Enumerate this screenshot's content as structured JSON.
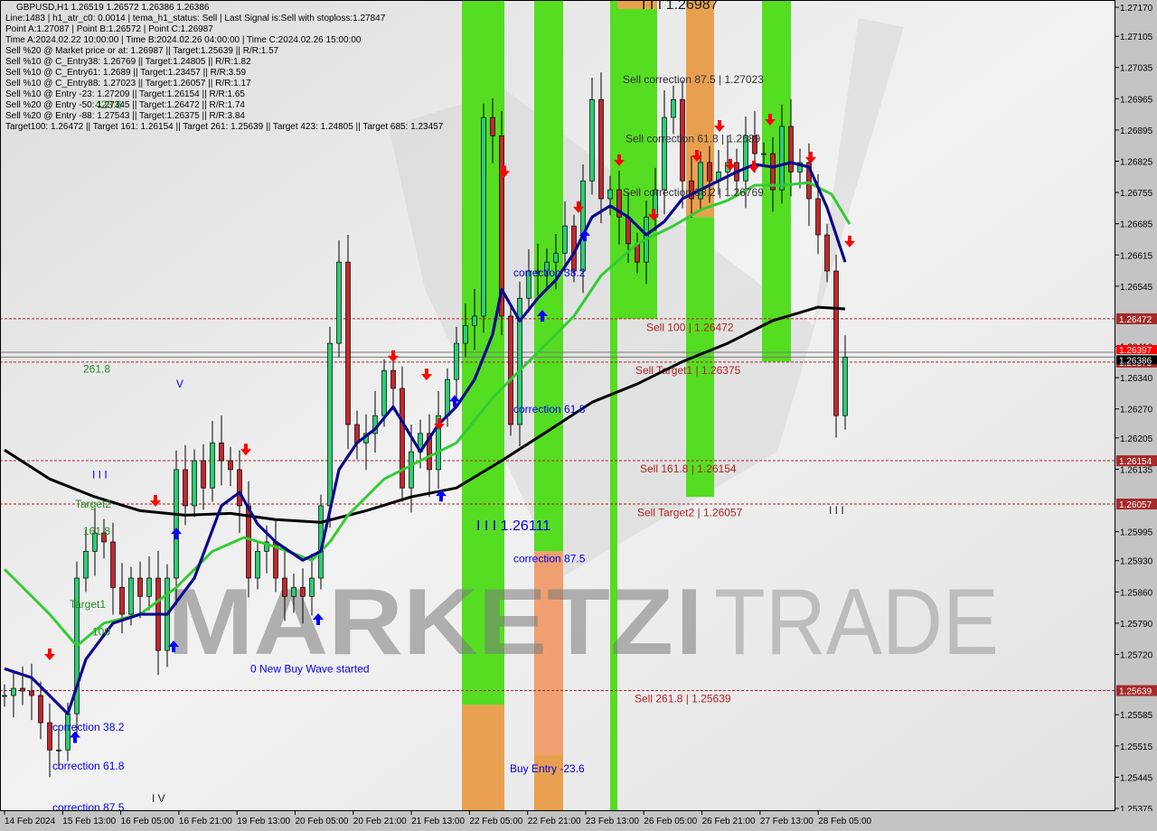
{
  "header": {
    "title": "GBPUSD,H1  1.26519 1.26572 1.26386 1.26386",
    "lines": [
      "Line:1483 | h1_atr_c0: 0.0014 | tema_h1_status: Sell | Last Signal is:Sell with stoploss:1.27847",
      "Point A:1.27087 | Point B:1.26572 | Point C:1.26987",
      "Time A:2024.02.22 10:00:00 | Time B:2024.02.26 04:00:00 | Time C:2024.02.26 15:00:00",
      "Sell %20 @ Market price or at: 1.26987 || Target:1.25639 || R/R:1.57",
      "Sell %10 @ C_Entry38: 1.26769 || Target:1.24805 || R/R:1.82",
      "Sell %10 @ C_Entry61: 1.2689 || Target:1.23457 || R/R:3.59",
      "Sell %10 @ C_Entry88: 1.27023 || Target:1.26057 || R/R:1.17",
      "Sell %10 @ Entry -23: 1.27209 || Target:1.26154 || R/R:1.65",
      "Sell %20 @ Entry -50: 1.27345 || Target:1.26472 || R/R:1.74",
      "Sell %20 @ Entry -88: 1.27543 || Target:1.26375 || R/R:3.84",
      "Target100: 1.26472 || Target 161: 1.26154 || Target 261: 1.25639 || Target 423: 1.24805 || Target 685: 1.23457"
    ]
  },
  "watermark": {
    "part1": "MARKETZ",
    "part2": "I",
    "part3": "TRADE"
  },
  "colors": {
    "bull": "#2ecc71",
    "bear": "#c0282d",
    "tema": "#0a0a8c",
    "ma_green": "#33cc33",
    "ma_black": "#000000",
    "zone_green": "#55dd22",
    "zone_orange": "#e8a050",
    "zone_salmon": "#f0a070",
    "level_red": "#b22222",
    "label_blue": "#0000ee"
  },
  "chart_data": {
    "type": "candlestick",
    "symbol": "GBPUSD",
    "timeframe": "H1",
    "ylim": [
      1.2534,
      1.2719
    ],
    "grid": false,
    "y_ticks": [
      "1.27170",
      "1.27105",
      "1.27035",
      "1.26965",
      "1.26895",
      "1.26825",
      "1.26755",
      "1.26685",
      "1.26615",
      "1.26545",
      "1.26410",
      "1.26340",
      "1.26270",
      "1.26205",
      "1.26135",
      "1.25995",
      "1.25930",
      "1.25860",
      "1.25790",
      "1.25720",
      "1.25585",
      "1.25515",
      "1.25445",
      "1.25375"
    ],
    "x_ticks": [
      "14 Feb 2024",
      "15 Feb 13:00",
      "16 Feb 05:00",
      "16 Feb 21:00",
      "19 Feb 13:00",
      "20 Feb 05:00",
      "20 Feb 21:00",
      "21 Feb 13:00",
      "22 Feb 05:00",
      "22 Feb 21:00",
      "23 Feb 13:00",
      "26 Feb 05:00",
      "26 Feb 21:00",
      "27 Feb 13:00",
      "28 Feb 05:00"
    ],
    "closes": [
      1.25628,
      1.25644,
      1.25638,
      1.25628,
      1.25567,
      1.25506,
      1.25506,
      1.25587,
      1.25891,
      1.25951,
      1.25992,
      1.25972,
      1.2587,
      1.2581,
      1.25891,
      1.2585,
      1.25891,
      1.25729,
      1.25891,
      1.26134,
      1.26053,
      1.26154,
      1.26093,
      1.26194,
      1.26154,
      1.26134,
      1.26053,
      1.25891,
      1.25951,
      1.25972,
      1.25891,
      1.2585,
      1.2587,
      1.2585,
      1.25891,
      1.26053,
      1.26417,
      1.26599,
      1.26235,
      1.26194,
      1.26215,
      1.26255,
      1.26356,
      1.26316,
      1.26093,
      1.26174,
      1.26215,
      1.26134,
      1.26255,
      1.26336,
      1.26417,
      1.26457,
      1.26478,
      1.26923,
      1.26882,
      1.26478,
      1.26235,
      1.26518,
      1.26579,
      1.26579,
      1.26599,
      1.26619,
      1.2668,
      1.26579,
      1.26781,
      1.26963,
      1.26741,
      1.26761,
      1.267,
      1.2664,
      1.26599,
      1.267,
      1.26761,
      1.26923,
      1.26963,
      1.26781,
      1.26741,
      1.26822,
      1.26781,
      1.26801,
      1.26822,
      1.26781,
      1.26882,
      1.26842,
      1.26842,
      1.26761,
      1.26903,
      1.26801,
      1.26822,
      1.26741,
      1.2666,
      1.26579,
      1.26255,
      1.26386
    ],
    "lines": {
      "ma_black": [
        [
          0,
          1.26178
        ],
        [
          5,
          1.26113
        ],
        [
          10,
          1.26073
        ],
        [
          15,
          1.26042
        ],
        [
          20,
          1.26032
        ],
        [
          25,
          1.26036
        ],
        [
          30,
          1.26022
        ],
        [
          35,
          1.26016
        ],
        [
          40,
          1.26042
        ],
        [
          45,
          1.26073
        ],
        [
          50,
          1.26093
        ],
        [
          55,
          1.26154
        ],
        [
          60,
          1.26219
        ],
        [
          65,
          1.26285
        ],
        [
          70,
          1.26326
        ],
        [
          75,
          1.26376
        ],
        [
          80,
          1.26417
        ],
        [
          85,
          1.26468
        ],
        [
          90,
          1.26498
        ],
        [
          93,
          1.26494
        ]
      ],
      "tema_blue": [
        [
          0,
          1.25688
        ],
        [
          3,
          1.25668
        ],
        [
          7,
          1.25587
        ],
        [
          9,
          1.25709
        ],
        [
          12,
          1.2579
        ],
        [
          15,
          1.2581
        ],
        [
          18,
          1.2581
        ],
        [
          21,
          1.25891
        ],
        [
          24,
          1.26053
        ],
        [
          26,
          1.26083
        ],
        [
          28,
          1.26012
        ],
        [
          30,
          1.25972
        ],
        [
          33,
          1.25931
        ],
        [
          35,
          1.25951
        ],
        [
          37,
          1.26134
        ],
        [
          39,
          1.26194
        ],
        [
          41,
          1.26225
        ],
        [
          43,
          1.26275
        ],
        [
          46,
          1.26174
        ],
        [
          48,
          1.26235
        ],
        [
          50,
          1.26275
        ],
        [
          52,
          1.26336
        ],
        [
          54,
          1.26437
        ],
        [
          55,
          1.26538
        ],
        [
          57,
          1.26467
        ],
        [
          59,
          1.26518
        ],
        [
          61,
          1.26559
        ],
        [
          63,
          1.26619
        ],
        [
          65,
          1.267
        ],
        [
          67,
          1.26725
        ],
        [
          69,
          1.267
        ],
        [
          71,
          1.2666
        ],
        [
          73,
          1.2669
        ],
        [
          75,
          1.26741
        ],
        [
          77,
          1.26761
        ],
        [
          79,
          1.26781
        ],
        [
          81,
          1.26801
        ],
        [
          83,
          1.26818
        ],
        [
          85,
          1.26812
        ],
        [
          87,
          1.26822
        ],
        [
          89,
          1.26812
        ],
        [
          91,
          1.26721
        ],
        [
          93,
          1.26599
        ]
      ],
      "ma_green": [
        [
          0,
          1.25911
        ],
        [
          5,
          1.2581
        ],
        [
          8,
          1.25739
        ],
        [
          11,
          1.2579
        ],
        [
          15,
          1.2581
        ],
        [
          19,
          1.2587
        ],
        [
          23,
          1.25951
        ],
        [
          26.5,
          1.25982
        ],
        [
          30,
          1.25961
        ],
        [
          34,
          1.25931
        ],
        [
          36,
          1.25972
        ],
        [
          38,
          1.26032
        ],
        [
          42,
          1.26113
        ],
        [
          46,
          1.26154
        ],
        [
          50,
          1.26194
        ],
        [
          54,
          1.26295
        ],
        [
          56.5,
          1.26346
        ],
        [
          60,
          1.26417
        ],
        [
          63,
          1.26478
        ],
        [
          66,
          1.26569
        ],
        [
          70,
          1.2664
        ],
        [
          74,
          1.2668
        ],
        [
          77,
          1.26716
        ],
        [
          80,
          1.26737
        ],
        [
          83,
          1.26771
        ],
        [
          86,
          1.26771
        ],
        [
          89,
          1.26777
        ],
        [
          91.5,
          1.26751
        ],
        [
          93.5,
          1.26684
        ]
      ]
    },
    "zones": [
      {
        "from": 50.6,
        "to": 55.3,
        "top": 1.2719,
        "bottom": 1.25607,
        "kind": "green"
      },
      {
        "from": 50.6,
        "to": 55.3,
        "top": 1.25607,
        "bottom": 1.2534,
        "kind": "orange"
      },
      {
        "from": 58.6,
        "to": 61.8,
        "top": 1.2719,
        "bottom": 1.25951,
        "kind": "green"
      },
      {
        "from": 58.6,
        "to": 61.8,
        "top": 1.25951,
        "bottom": 1.25496,
        "kind": "salmon"
      },
      {
        "from": 58.6,
        "to": 61.8,
        "top": 1.25496,
        "bottom": 1.2534,
        "kind": "orange"
      },
      {
        "from": 67.0,
        "to": 72.2,
        "top": 1.2719,
        "bottom": 1.26472,
        "kind": "green"
      },
      {
        "from": 67.0,
        "to": 67.8,
        "top": 1.26472,
        "bottom": 1.2534,
        "kind": "green"
      },
      {
        "from": 67.8,
        "to": 72.2,
        "top": 1.2719,
        "bottom": 1.27166,
        "kind": "orange"
      },
      {
        "from": 75.4,
        "to": 78.5,
        "top": 1.2719,
        "bottom": 1.267,
        "kind": "orange"
      },
      {
        "from": 75.4,
        "to": 78.5,
        "top": 1.267,
        "bottom": 1.26073,
        "kind": "green"
      },
      {
        "from": 83.8,
        "to": 87.0,
        "top": 1.2719,
        "bottom": 1.26376,
        "kind": "green"
      }
    ],
    "levels": [
      {
        "price": 1.26472,
        "label": "Sell 100 | 1.26472",
        "label_index": 71,
        "label_price": 1.26453,
        "style": "dashed"
      },
      {
        "price": 1.26375,
        "label": "Sell Target1 | 1.26375",
        "label_index": 69.8,
        "label_price": 1.26356,
        "style": "dashed"
      },
      {
        "price": 1.26154,
        "label": "Sell 161.8 | 1.26154",
        "label_index": 70.3,
        "label_price": 1.26136,
        "style": "dashed"
      },
      {
        "price": 1.26057,
        "label": "Sell Target2 | 1.26057",
        "label_index": 70,
        "label_price": 1.26038,
        "style": "dashed"
      },
      {
        "price": 1.25639,
        "label": "Sell  261.8 | 1.25639",
        "label_index": 69.7,
        "label_price": 1.25621,
        "style": "dashed"
      }
    ],
    "price_lines": [
      {
        "price": 1.26397,
        "tag": "1.26397",
        "tag_color": "#ff0000"
      },
      {
        "price": 1.26386,
        "tag": "1.26386",
        "tag_color": "#000000"
      }
    ],
    "price_tags": [
      "1.26472",
      "1.26375",
      "1.26154",
      "1.26057",
      "1.25639"
    ],
    "annotations": [
      {
        "text": "correction 38.2",
        "index": 56.3,
        "price": 1.26575,
        "color": "blue"
      },
      {
        "text": "correction 61.8",
        "index": 56.3,
        "price": 1.26269,
        "color": "blue"
      },
      {
        "text": "correction 87.5",
        "index": 56.3,
        "price": 1.25935,
        "color": "blue"
      },
      {
        "text": "Buy Entry -23.6",
        "index": 55.9,
        "price": 1.25464,
        "color": "blue"
      },
      {
        "text": "0 New Buy Wave started",
        "index": 27.2,
        "price": 1.25688,
        "color": "blue"
      },
      {
        "text": "correction 38.2",
        "index": 5.3,
        "price": 1.25557,
        "color": "blue"
      },
      {
        "text": "correction 61.8",
        "index": 5.3,
        "price": 1.2547,
        "color": "blue"
      },
      {
        "text": "correction 87.5",
        "index": 5.3,
        "price": 1.25377,
        "color": "blue"
      },
      {
        "text": "I I I 1.26111",
        "index": 52.2,
        "price": 1.26006,
        "color": "blue",
        "big": true
      },
      {
        "text": "I I I 1.26987",
        "index": 70.5,
        "price": 1.27174,
        "color": "dark",
        "big": true
      },
      {
        "text": "Sell correction 87.5 | 1.27023",
        "index": 68.4,
        "price": 1.27008,
        "color": "gray"
      },
      {
        "text": "Sell correction 61.8 | 1.2689",
        "index": 68.7,
        "price": 1.26876,
        "color": "gray"
      },
      {
        "text": "Sell correction 38.2 | 1.26769",
        "index": 68.4,
        "price": 1.26755,
        "color": "gray"
      },
      {
        "text": "261.8",
        "index": 8.7,
        "price": 1.2636,
        "color": "green"
      },
      {
        "text": "Target2",
        "index": 7.8,
        "price": 1.26057,
        "color": "green"
      },
      {
        "text": "161.8",
        "index": 8.7,
        "price": 1.25996,
        "color": "green"
      },
      {
        "text": "Target1",
        "index": 7.2,
        "price": 1.25832,
        "color": "green"
      },
      {
        "text": "100",
        "index": 9.7,
        "price": 1.25771,
        "color": "green"
      },
      {
        "text": "423.6",
        "index": 10.0,
        "price": 1.26951,
        "color": "green"
      },
      {
        "text": "V",
        "index": 19.0,
        "price": 1.26326,
        "color": "blue"
      },
      {
        "text": "I I I",
        "index": 9.7,
        "price": 1.26123,
        "color": "blue"
      },
      {
        "text": "I V",
        "index": 16.3,
        "price": 1.25397,
        "color": "dark"
      },
      {
        "text": "I I I",
        "index": 91.2,
        "price": 1.26043,
        "color": "dark"
      }
    ],
    "sell_arrows": [
      [
        5,
        1.25719
      ],
      [
        16.7,
        1.26063
      ],
      [
        26.7,
        1.26178
      ],
      [
        43,
        1.26387
      ],
      [
        46.7,
        1.26346
      ],
      [
        48.1,
        1.26235
      ],
      [
        55.3,
        1.26801
      ],
      [
        63.5,
        1.26721
      ],
      [
        68,
        1.26826
      ],
      [
        71.8,
        1.26704
      ],
      [
        76.6,
        1.26836
      ],
      [
        79.1,
        1.26903
      ],
      [
        80.3,
        1.26816
      ],
      [
        82.9,
        1.26812
      ],
      [
        84.7,
        1.26917
      ],
      [
        89.2,
        1.26832
      ],
      [
        93.5,
        1.26644
      ]
    ],
    "buy_arrows": [
      [
        7.8,
        1.25536
      ],
      [
        18.7,
        1.25739
      ],
      [
        19,
        1.25992
      ],
      [
        34.7,
        1.258
      ],
      [
        48.3,
        1.26077
      ],
      [
        49.8,
        1.26289
      ],
      [
        59.5,
        1.2648
      ],
      [
        64.2,
        1.2666
      ]
    ]
  }
}
